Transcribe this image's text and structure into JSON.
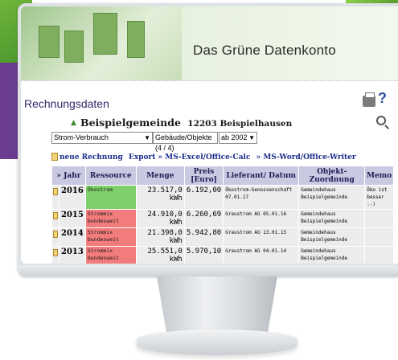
{
  "banner": {
    "title": "Das Grüne Datenkonto"
  },
  "page": {
    "title": "Rechnungsdaten"
  },
  "gemeinde": {
    "name": "Beispielgemeinde",
    "code": "12203 Beispielhausen"
  },
  "filters": {
    "energy": "Strom-Verbrauch",
    "objects": "Gebäude/Objekte (4 / 4)",
    "since": "ab 2002"
  },
  "actions": {
    "new": "neue Rechnung",
    "export_excel": "Export » MS-Excel/Office-Calc",
    "export_word": "» MS-Word/Office-Writer"
  },
  "table": {
    "headers": {
      "year": "» Jahr",
      "resource": "Ressource",
      "amount": "Menge",
      "price": "Preis [Euro]",
      "supplier": "Lieferant/ Datum",
      "object": "Objekt-Zuordnung",
      "memo": "Memo"
    },
    "rows": [
      {
        "year": "2016",
        "resource": "Ökostrom",
        "amount": "23.517,0 kWh",
        "price": "6.192,00",
        "supplier": "Ökostrom-Genossenschaft 07.01.17",
        "object": "Gemeindehaus Beispielgemeinde",
        "memo": "Öko ist besser :-)"
      },
      {
        "year": "2015",
        "resource": "Strommix bundesweit",
        "amount": "24.910,0 kWh",
        "price": "6.260,69",
        "supplier": "Graustrom AG 05.01.16",
        "object": "Gemeindehaus Beispielgemeinde",
        "memo": ""
      },
      {
        "year": "2014",
        "resource": "Strommix bundesweit",
        "amount": "21.398,0 kWh",
        "price": "5.942,80",
        "supplier": "Graustrom AG 13.01.15",
        "object": "Gemeindehaus Beispielgemeinde",
        "memo": ""
      },
      {
        "year": "2013",
        "resource": "Strommix bundesweit",
        "amount": "25.551,0 kWh",
        "price": "5.970,10",
        "supplier": "Graustrom AG 04.01.14",
        "object": "Gemeindehaus Beispielgemeinde",
        "memo": ""
      }
    ]
  },
  "colors": {
    "resource_eco": "#7fd06a",
    "resource_mix": "#f27b7b",
    "header_bg": "#c9c9e2"
  },
  "icons": [
    "printer-icon",
    "help-icon",
    "zoom-icon",
    "up-arrow-icon",
    "document-icon",
    "pencil-icon"
  ]
}
